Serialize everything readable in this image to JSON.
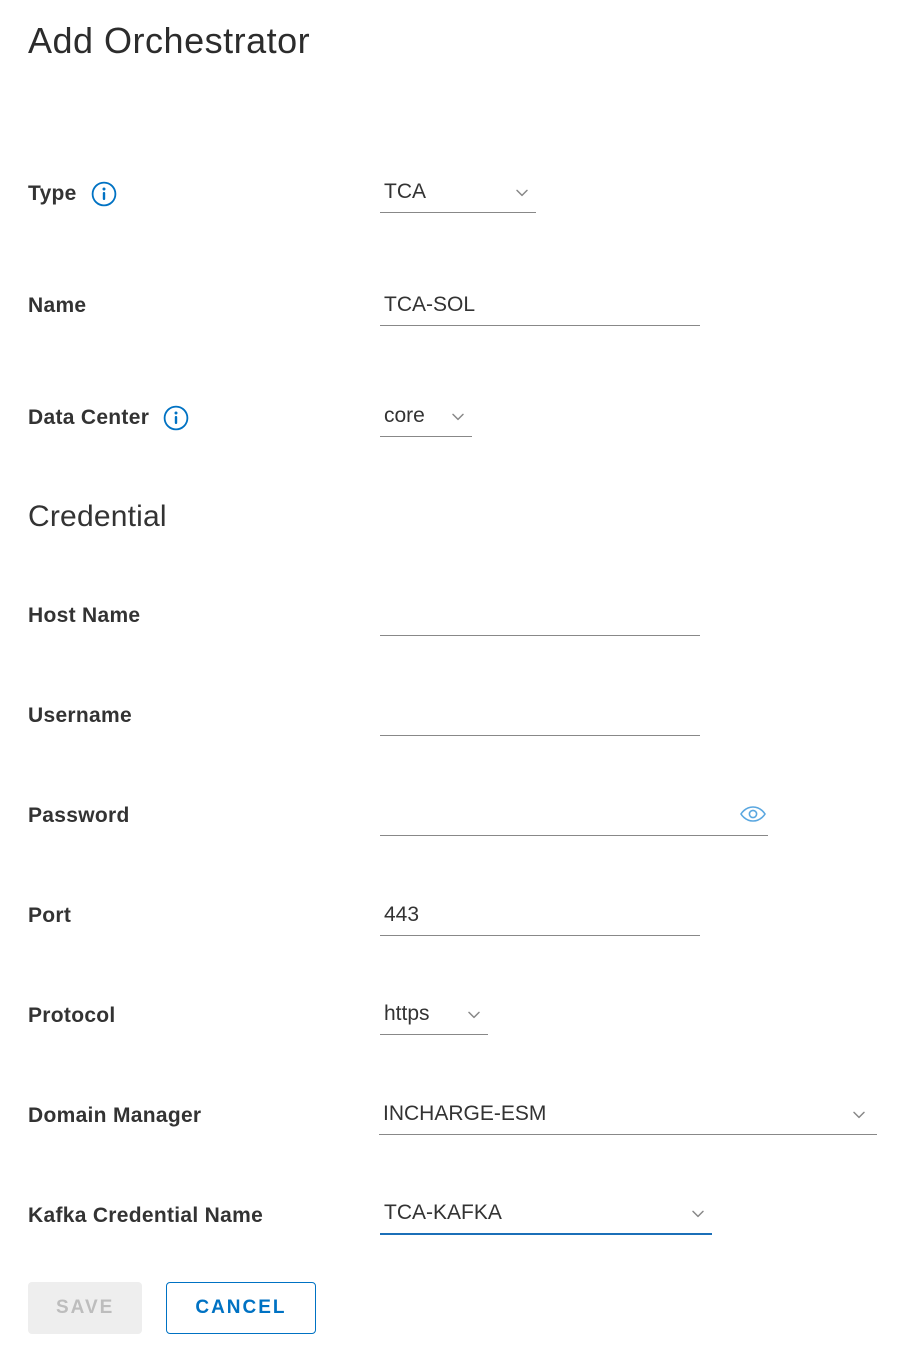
{
  "page": {
    "title": "Add Orchestrator"
  },
  "form": {
    "type_label": "Type",
    "type_value": "TCA",
    "name_label": "Name",
    "name_value": "TCA-SOL",
    "datacenter_label": "Data Center",
    "datacenter_value": "core"
  },
  "credential": {
    "section_title": "Credential",
    "hostname_label": "Host Name",
    "hostname_value": "",
    "username_label": "Username",
    "username_value": "",
    "password_label": "Password",
    "password_value": "",
    "port_label": "Port",
    "port_value": "443",
    "protocol_label": "Protocol",
    "protocol_value": "https",
    "domain_manager_label": "Domain Manager",
    "domain_manager_value": "INCHARGE-ESM",
    "kafka_label": "Kafka Credential Name",
    "kafka_value": "TCA-KAFKA"
  },
  "buttons": {
    "save": "SAVE",
    "cancel": "CANCEL"
  }
}
